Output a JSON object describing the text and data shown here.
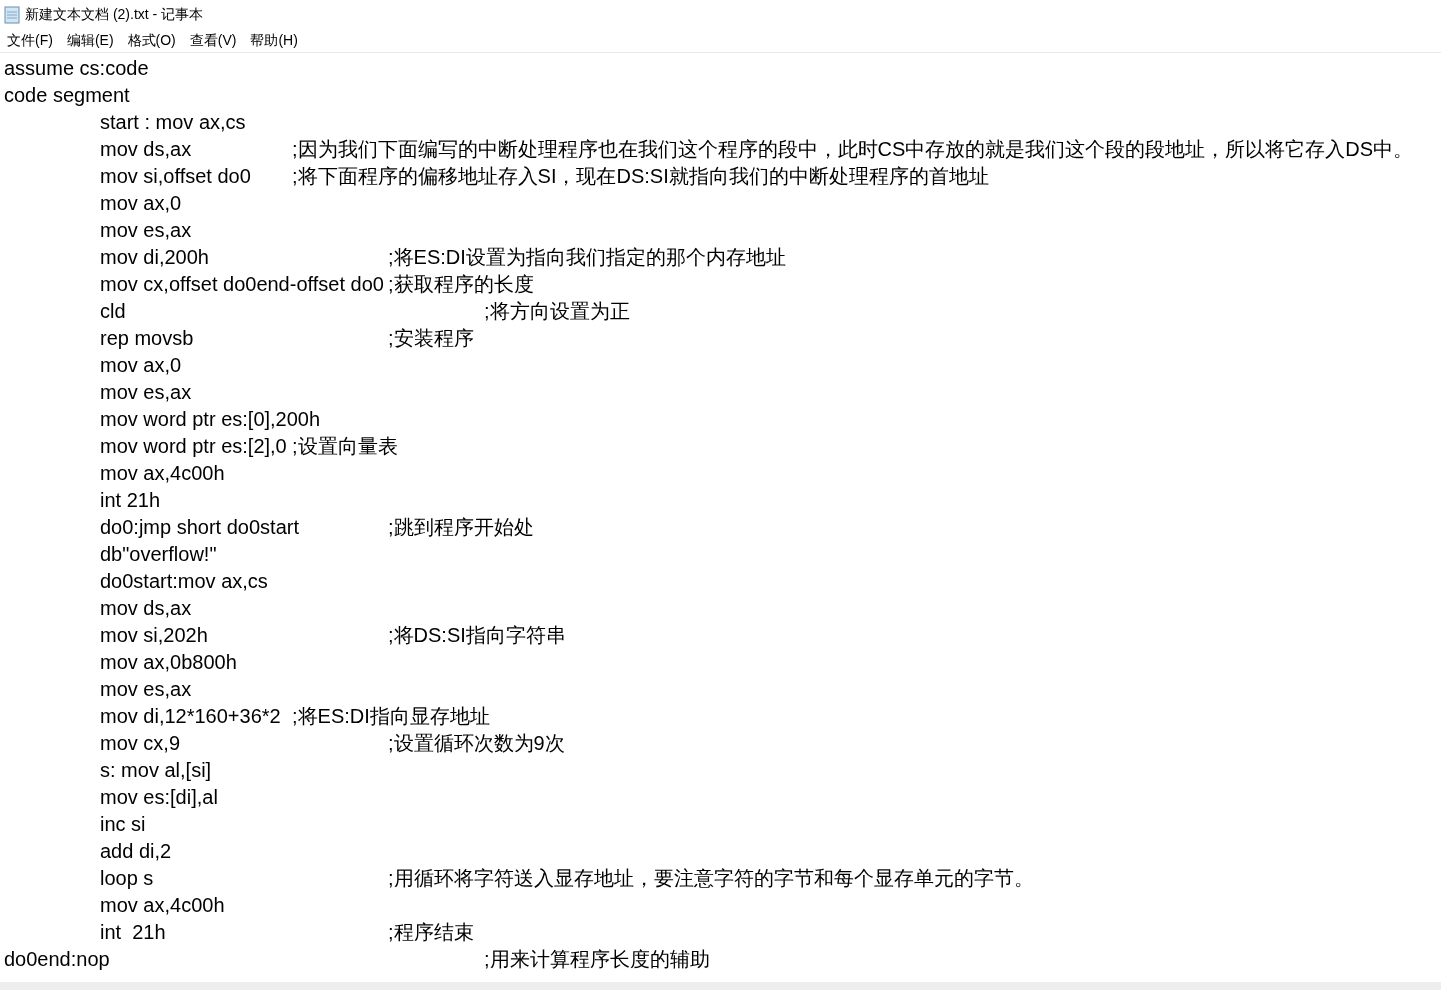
{
  "window": {
    "title": "新建文本文档 (2).txt - 记事本"
  },
  "menu": [
    "文件(F)",
    "编辑(E)",
    "格式(O)",
    "查看(V)",
    "帮助(H)"
  ],
  "editor": {
    "lines": [
      "assume cs:code",
      "code segment",
      "\tstart : mov ax,cs",
      "\tmov ds,ax\t\t;因为我们下面编写的中断处理程序也在我们这个程序的段中，此时CS中存放的就是我们这个段的段地址，所以将它存入DS中。",
      "\tmov si,offset do0\t;将下面程序的偏移地址存入SI，现在DS:SI就指向我们的中断处理程序的首地址",
      "\tmov ax,0",
      "\tmov es,ax",
      "\tmov di,200h\t\t;将ES:DI设置为指向我们指定的那个内存地址",
      "\tmov cx,offset do0end-offset do0\t;获取程序的长度",
      "\tcld\t\t\t\t;将方向设置为正",
      "\trep movsb\t\t;安装程序",
      "\tmov ax,0",
      "\tmov es,ax",
      "\tmov word ptr es:[0],200h",
      "\tmov word ptr es:[2],0\t;设置向量表",
      "\tmov ax,4c00h",
      "\tint 21h",
      "\tdo0:jmp short do0start\t;跳到程序开始处",
      "\tdb\"overflow!\"",
      "\tdo0start:mov ax,cs",
      "\tmov ds,ax",
      "\tmov si,202h\t\t;将DS:SI指向字符串",
      "\tmov ax,0b800h",
      "\tmov es,ax",
      "\tmov di,12*160+36*2\t;将ES:DI指向显存地址",
      "\tmov cx,9\t\t\t;设置循环次数为9次",
      "\ts: mov al,[si]",
      "\tmov es:[di],al",
      "\tinc si",
      "\tadd di,2",
      "\tloop s\t\t\t;用循环将字符送入显存地址，要注意字符的字节和每个显存单元的字节。",
      "\tmov ax,4c00h",
      "\tint  21h\t\t\t;程序结束",
      "do0end:nop\t\t\t\t;用来计算程序长度的辅助"
    ]
  }
}
